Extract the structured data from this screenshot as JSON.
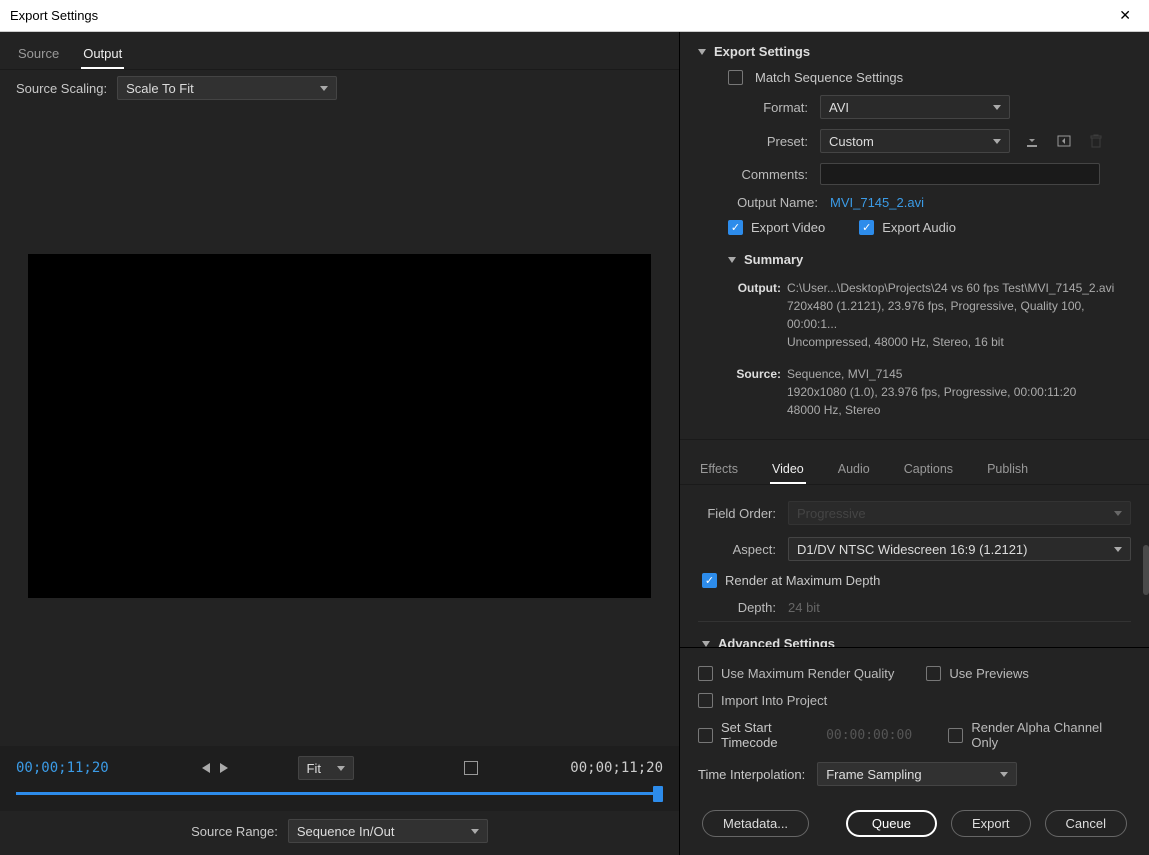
{
  "window": {
    "title": "Export Settings"
  },
  "left": {
    "tabs": [
      "Source",
      "Output"
    ],
    "active_tab": "Output",
    "scaling_label": "Source Scaling:",
    "scaling_value": "Scale To Fit",
    "timecode_current": "00;00;11;20",
    "timecode_total": "00;00;11;20",
    "fit_label": "Fit",
    "source_range_label": "Source Range:",
    "source_range_value": "Sequence In/Out"
  },
  "export_settings": {
    "title": "Export Settings",
    "match_seq_label": "Match Sequence Settings",
    "format_label": "Format:",
    "format_value": "AVI",
    "preset_label": "Preset:",
    "preset_value": "Custom",
    "comments_label": "Comments:",
    "output_name_label": "Output Name:",
    "output_name_value": "MVI_7145_2.avi",
    "export_video_label": "Export Video",
    "export_audio_label": "Export Audio",
    "summary_title": "Summary",
    "summary_output_label": "Output:",
    "summary_output_path": "C:\\User...\\Desktop\\Projects\\24 vs 60 fps Test\\MVI_7145_2.avi",
    "summary_output_line2": "720x480 (1.2121), 23.976 fps, Progressive, Quality 100, 00:00:1...",
    "summary_output_line3": "Uncompressed, 48000 Hz, Stereo, 16 bit",
    "summary_source_label": "Source:",
    "summary_source_line1": "Sequence, MVI_7145",
    "summary_source_line2": "1920x1080 (1.0), 23.976 fps, Progressive, 00:00:11:20",
    "summary_source_line3": "48000 Hz, Stereo"
  },
  "tabs2": [
    "Effects",
    "Video",
    "Audio",
    "Captions",
    "Publish"
  ],
  "tabs2_active": "Video",
  "video": {
    "field_order_label": "Field Order:",
    "field_order_value": "Progressive",
    "aspect_label": "Aspect:",
    "aspect_value": "D1/DV NTSC Widescreen 16:9 (1.2121)",
    "render_max_depth_label": "Render at Maximum Depth",
    "depth_label": "Depth:",
    "depth_value": "24 bit",
    "advanced_title": "Advanced Settings"
  },
  "bottom": {
    "use_max_quality": "Use Maximum Render Quality",
    "use_previews": "Use Previews",
    "import_project": "Import Into Project",
    "start_timecode": "Set Start Timecode",
    "start_timecode_value": "00:00:00:00",
    "render_alpha": "Render Alpha Channel Only",
    "time_interp_label": "Time Interpolation:",
    "time_interp_value": "Frame Sampling",
    "btn_metadata": "Metadata...",
    "btn_queue": "Queue",
    "btn_export": "Export",
    "btn_cancel": "Cancel"
  }
}
